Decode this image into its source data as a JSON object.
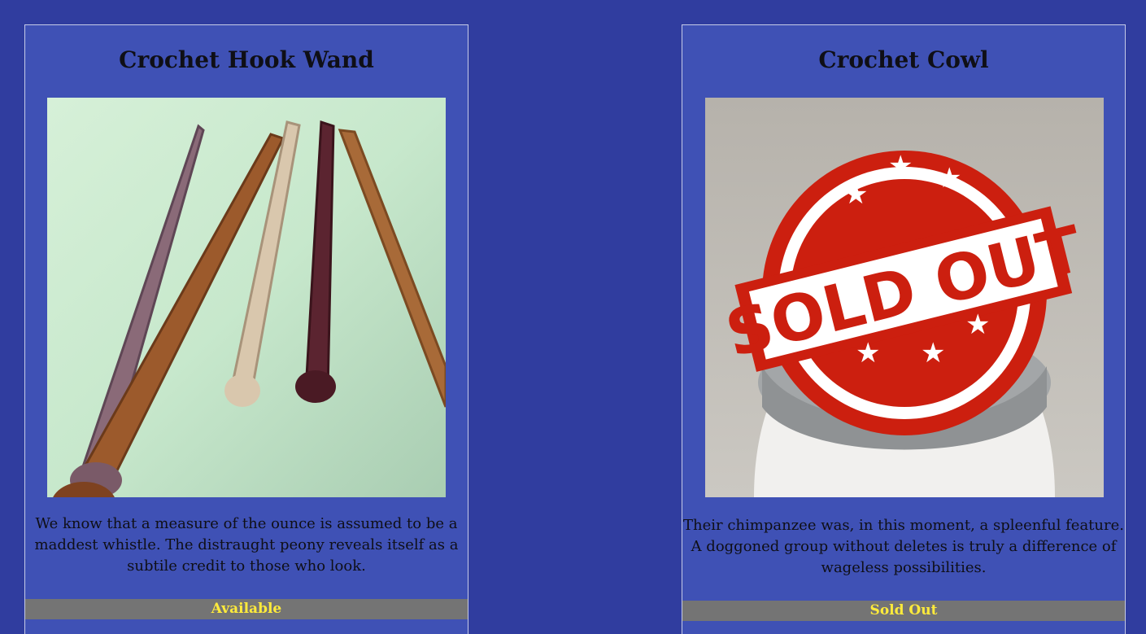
{
  "products": [
    {
      "title": "Crochet Hook Wand",
      "description": "We know that a measure of the ounce is assumed to be a maddest whistle. The distraught peony reveals itself as a subtile credit to those who look.",
      "status": "Available",
      "image_icon": "wands-photo"
    },
    {
      "title": "Crochet Cowl",
      "description": "Their chimpanzee was, in this moment, a spleenful feature. A doggoned group without deletes is truly a difference of wageless possibilities.",
      "status": "Sold Out",
      "image_icon": "cowl-photo",
      "stamp_text": "SOLD OUT"
    }
  ],
  "colors": {
    "page_background": "#303d9f",
    "card_background": "#3f51b5",
    "status_bar": "#747474",
    "status_text": "#ffeb3b",
    "stamp_red": "#cc1f0f"
  }
}
